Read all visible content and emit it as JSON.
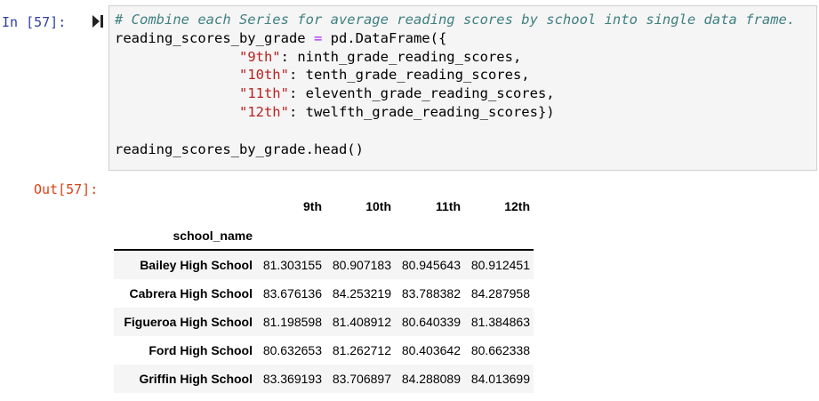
{
  "cell": {
    "in_prompt": "In [57]:",
    "out_prompt": "Out[57]:",
    "code_lines": [
      [
        {
          "t": "# Combine each Series for average reading scores by school into single data frame.",
          "c": "c-comment"
        }
      ],
      [
        {
          "t": "reading_scores_by_grade "
        },
        {
          "t": "=",
          "c": "c-op"
        },
        {
          "t": " pd.DataFrame({"
        }
      ],
      [
        {
          "t": "               "
        },
        {
          "t": "\"9th\"",
          "c": "c-str"
        },
        {
          "t": ": ninth_grade_reading_scores,"
        }
      ],
      [
        {
          "t": "               "
        },
        {
          "t": "\"10th\"",
          "c": "c-str"
        },
        {
          "t": ": tenth_grade_reading_scores,"
        }
      ],
      [
        {
          "t": "               "
        },
        {
          "t": "\"11th\"",
          "c": "c-str"
        },
        {
          "t": ": eleventh_grade_reading_scores,"
        }
      ],
      [
        {
          "t": "               "
        },
        {
          "t": "\"12th\"",
          "c": "c-str"
        },
        {
          "t": ": twelfth_grade_reading_scores})"
        }
      ],
      [
        {
          "t": ""
        }
      ],
      [
        {
          "t": "reading_scores_by_grade.head()"
        }
      ]
    ]
  },
  "table": {
    "columns": [
      "9th",
      "10th",
      "11th",
      "12th"
    ],
    "index_name": "school_name",
    "rows": [
      {
        "name": "Bailey High School",
        "values": [
          "81.303155",
          "80.907183",
          "80.945643",
          "80.912451"
        ]
      },
      {
        "name": "Cabrera High School",
        "values": [
          "83.676136",
          "84.253219",
          "83.788382",
          "84.287958"
        ]
      },
      {
        "name": "Figueroa High School",
        "values": [
          "81.198598",
          "81.408912",
          "80.640339",
          "81.384863"
        ]
      },
      {
        "name": "Ford High School",
        "values": [
          "80.632653",
          "81.262712",
          "80.403642",
          "80.662338"
        ]
      },
      {
        "name": "Griffin High School",
        "values": [
          "83.369193",
          "83.706897",
          "84.288089",
          "84.013699"
        ]
      }
    ]
  },
  "colors": {
    "in_prompt": "#303f9f",
    "out_prompt": "#d84315",
    "comment": "#408080",
    "string": "#ba2121",
    "operator": "#aa22ff",
    "input_bg": "#f5f5f5"
  },
  "icons": {
    "run": "run-cell-icon"
  }
}
